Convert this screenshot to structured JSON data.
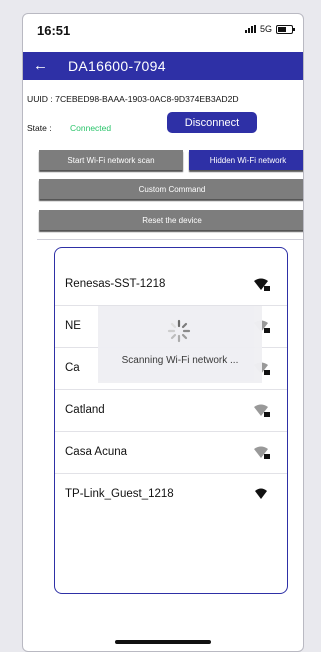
{
  "status_bar": {
    "time": "16:51",
    "network": "5G"
  },
  "app_bar": {
    "back_icon": "arrow-left-icon",
    "title": "DA16600-7094"
  },
  "device": {
    "uuid": "UUID : 7CEBED98-BAAA-1903-0AC8-9D374EB3AD2D",
    "state_label": "State :",
    "state_value": "Connected",
    "state_color": "#29c46a"
  },
  "buttons": {
    "disconnect": "Disconnect",
    "start_scan": "Start Wi-Fi network scan",
    "hidden_network": "Hidden Wi-Fi network",
    "custom_command": "Custom Command",
    "reset_device": "Reset the device"
  },
  "networks": [
    {
      "name": "Renesas-SST-1218",
      "icon": "wifi-secured-icon"
    },
    {
      "name": "NE",
      "icon": "wifi-secured-icon"
    },
    {
      "name": "Ca",
      "icon": "wifi-secured-icon"
    },
    {
      "name": "Catland",
      "icon": "wifi-secured-icon"
    },
    {
      "name": "Casa Acuna",
      "icon": "wifi-secured-icon"
    },
    {
      "name": "TP-Link_Guest_1218",
      "icon": "wifi-open-icon"
    }
  ],
  "overlay": {
    "message": "Scanning Wi-Fi network ...",
    "icon": "spinner-icon"
  },
  "colors": {
    "primary": "#2e30a6",
    "button_gray": "#7d7d7d"
  }
}
